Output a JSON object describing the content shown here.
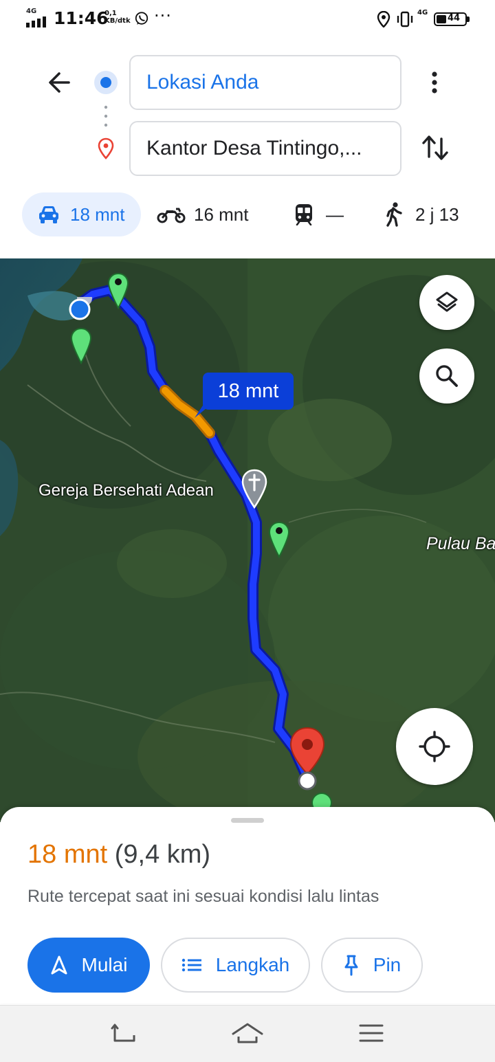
{
  "status_bar": {
    "network": "4G",
    "time": "11:46",
    "speed_value": "0,1",
    "speed_unit": "KB/dtk",
    "network_right": "4G",
    "battery": "44"
  },
  "directions": {
    "origin": "Lokasi Anda",
    "destination": "Kantor Desa Tintingo,..."
  },
  "modes": [
    {
      "label": "18 mnt",
      "icon": "car-icon",
      "selected": true
    },
    {
      "label": "16 mnt",
      "icon": "motorcycle-icon"
    },
    {
      "label": "—",
      "icon": "transit-icon"
    },
    {
      "label": "2 j 13",
      "icon": "walk-icon"
    }
  ],
  "map": {
    "eta_label": "18 mnt",
    "labels": {
      "church": "Gereja Bersehati Adean",
      "island": "Pulau Ba"
    }
  },
  "sheet": {
    "duration": "18 mnt",
    "distance": "(9,4 km)",
    "description": "Rute tercepat saat ini sesuai kondisi lalu lintas",
    "buttons": {
      "start": "Mulai",
      "steps": "Langkah",
      "pin": "Pin"
    }
  },
  "colors": {
    "accent": "#1a73e8",
    "duration": "#e37400",
    "route": "#1e3cff",
    "traffic": "#f29900",
    "destination_pin": "#ea4335"
  }
}
